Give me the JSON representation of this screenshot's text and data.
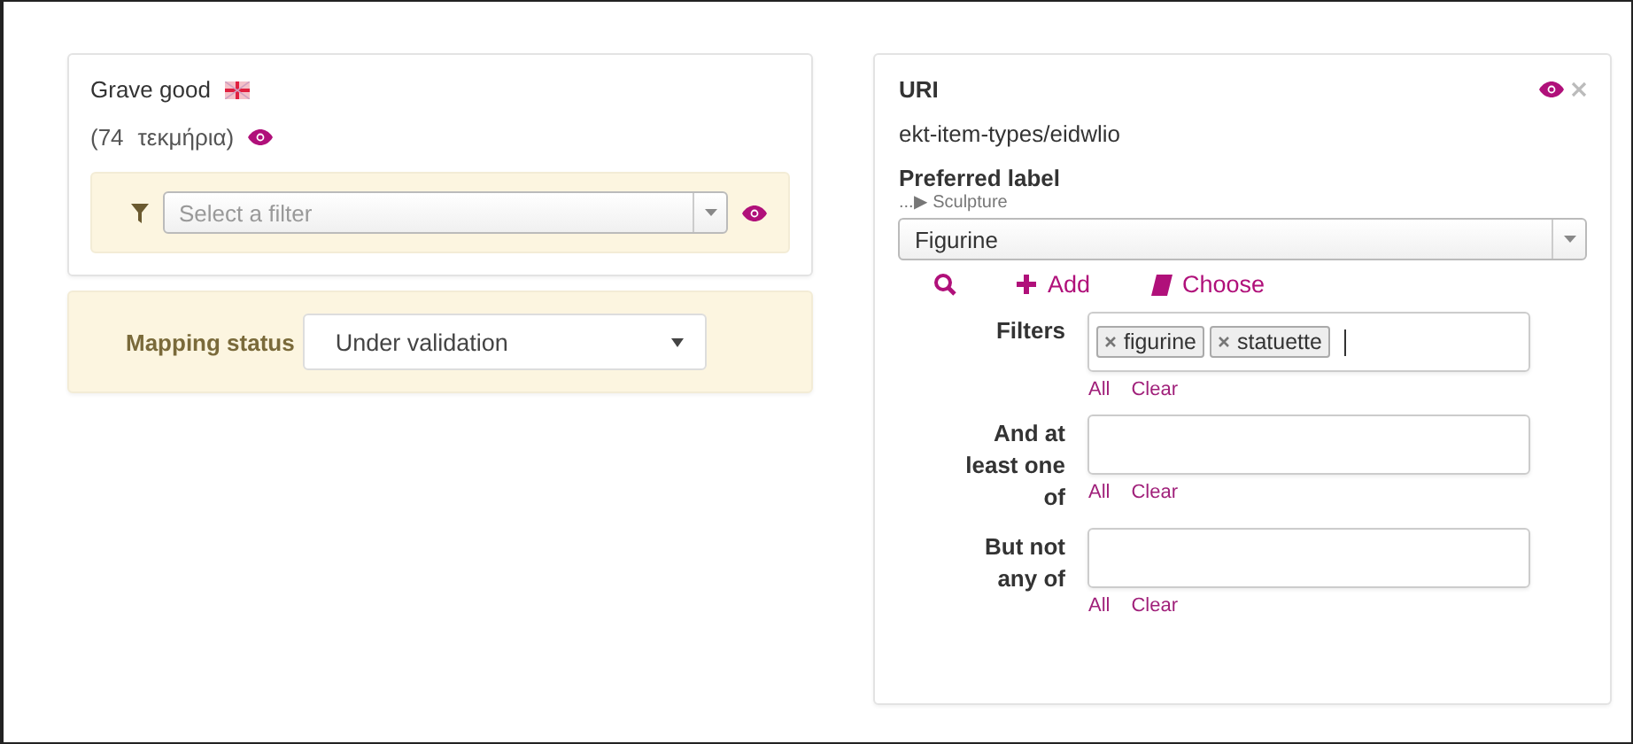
{
  "term": {
    "title": "Grave good",
    "count": "(74",
    "count_label": "τεκμήρια)",
    "filter": {
      "placeholder": "Select a filter"
    }
  },
  "mapping_status": {
    "label": "Mapping status",
    "value": "Under validation"
  },
  "detail": {
    "uri_label": "URI",
    "uri": "ekt-item-types/eidwlio",
    "preferred_label": "Preferred label",
    "breadcrumb": "...▶ Sculpture",
    "selected_value": "Figurine",
    "actions": [
      {
        "kind": "search"
      },
      {
        "kind": "add",
        "label": "Add"
      },
      {
        "kind": "choose",
        "label": "Choose"
      }
    ],
    "filter_groups": [
      {
        "label": "Filters",
        "tags": [
          "figurine",
          "statuette"
        ],
        "cursor": true,
        "links": [
          "All",
          "Clear"
        ]
      },
      {
        "label": "And at least one of",
        "cursor": false,
        "links": [
          "All",
          "Clear"
        ]
      },
      {
        "label": "But not any of",
        "cursor": false,
        "links": [
          "All",
          "Clear"
        ]
      }
    ]
  }
}
